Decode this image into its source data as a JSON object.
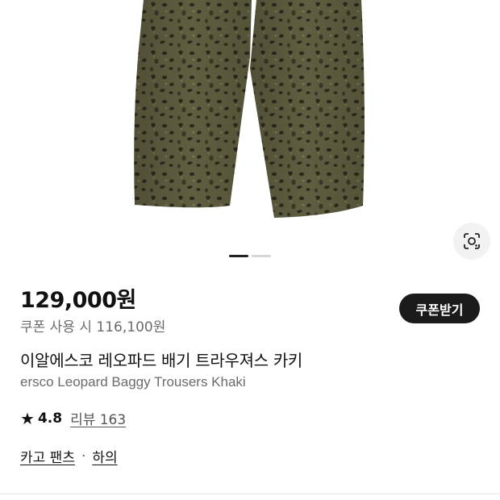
{
  "product": {
    "price": "129,000원",
    "coupon_price": "쿠폰 사용 시 116,100원",
    "coupon_button_label": "쿠폰받기",
    "title_ko": "이알에스코 레오파드 배기 트라우져스 카키",
    "title_en": "ersco Leopard Baggy Trousers Khaki",
    "rating": "4.8",
    "review_label": "리뷰 163",
    "categories": [
      "카고 팬츠",
      "하의"
    ],
    "category_separator": "·"
  },
  "gallery": {
    "total_images": 2,
    "current_index": 1
  },
  "icons": {
    "lens": "visual-search-icon",
    "star": "star-icon"
  },
  "colors": {
    "fabric_base": "#5f5e40",
    "spot_dark": "#2c2a1c",
    "button_bg": "#1b1b1b"
  }
}
